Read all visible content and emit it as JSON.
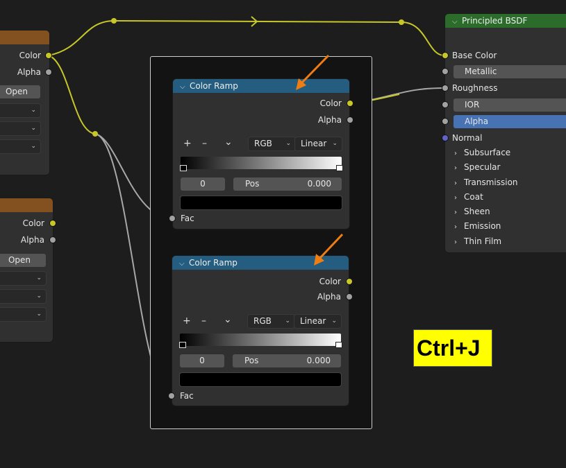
{
  "left_node_1": {
    "outputs": [
      {
        "label": "Color"
      },
      {
        "label": "Alpha"
      }
    ],
    "open_label": "Open"
  },
  "left_node_2": {
    "outputs": [
      {
        "label": "Color"
      },
      {
        "label": "Alpha"
      }
    ],
    "open_label": "Open"
  },
  "color_ramp_1": {
    "title": "Color Ramp",
    "outputs": [
      {
        "label": "Color"
      },
      {
        "label": "Alpha"
      }
    ],
    "add_icon": "+",
    "remove_icon": "–",
    "menu_icon": "⌄",
    "color_mode": "RGB",
    "interpolation": "Linear",
    "stop_index": "0",
    "pos_label": "Pos",
    "pos_value": "0.000",
    "input_label": "Fac"
  },
  "color_ramp_2": {
    "title": "Color Ramp",
    "outputs": [
      {
        "label": "Color"
      },
      {
        "label": "Alpha"
      }
    ],
    "add_icon": "+",
    "remove_icon": "–",
    "menu_icon": "⌄",
    "color_mode": "RGB",
    "interpolation": "Linear",
    "stop_index": "0",
    "pos_label": "Pos",
    "pos_value": "0.000",
    "input_label": "Fac"
  },
  "principled_bsdf": {
    "title": "Principled BSDF",
    "base_color": "Base Color",
    "metallic": "Metallic",
    "roughness": "Roughness",
    "ior": "IOR",
    "alpha": "Alpha",
    "normal": "Normal",
    "panels": [
      {
        "label": "Subsurface"
      },
      {
        "label": "Specular"
      },
      {
        "label": "Transmission"
      },
      {
        "label": "Coat"
      },
      {
        "label": "Sheen"
      },
      {
        "label": "Emission"
      },
      {
        "label": "Thin Film"
      }
    ]
  },
  "shortcut_badge": "Ctrl+J",
  "colors": {
    "socket_color": "#c7c729",
    "socket_gray": "#a1a1a1",
    "socket_vector": "#6363c7",
    "wire_yellow": "#c7c729",
    "wire_gray": "#a8a8a8",
    "header_texture": "#83511f",
    "header_converter": "#245d80",
    "header_shader": "#2b6c2b",
    "arrow_orange": "#f07d12",
    "active_field": "#4772b3",
    "badge_yellow": "#ffff00"
  }
}
